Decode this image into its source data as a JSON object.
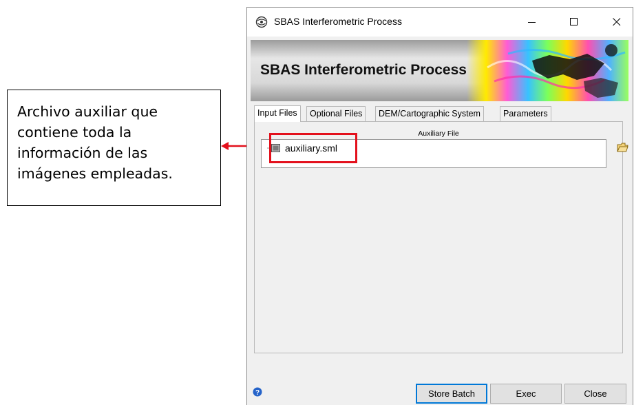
{
  "annotation": {
    "lines": [
      "Archivo auxiliar que",
      "contiene toda la",
      "información de las",
      "imágenes empleadas."
    ]
  },
  "window": {
    "title": "SBAS Interferometric Process",
    "controls": {
      "minimize": "─",
      "maximize": "☐",
      "close": "✕"
    }
  },
  "banner": {
    "title": "SBAS Interferometric Process"
  },
  "tabs": [
    {
      "label": "Input Files",
      "active": true
    },
    {
      "label": "Optional Files",
      "active": false
    },
    {
      "label": "DEM/Cartographic System",
      "active": false
    },
    {
      "label": "Parameters",
      "active": false
    }
  ],
  "input_files": {
    "field_label": "Auxiliary File",
    "file_name": "auxiliary.sml",
    "browse_icon": "open-folder-icon"
  },
  "footer": {
    "help_icon": "help-icon",
    "store_batch_label": "Store Batch",
    "exec_label": "Exec",
    "close_label": "Close"
  },
  "colors": {
    "highlight": "#e3101c",
    "default_button_border": "#0078d7"
  }
}
